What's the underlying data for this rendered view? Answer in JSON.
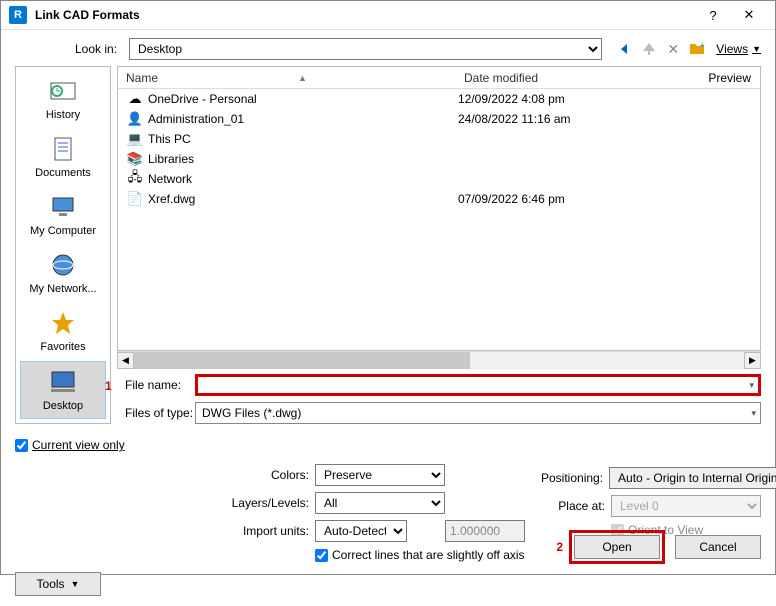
{
  "title": "Link CAD Formats",
  "lookin": {
    "label": "Look in:",
    "value": "Desktop"
  },
  "toolbar": {
    "views": "Views"
  },
  "preview_label": "Preview",
  "places": [
    {
      "label": "History"
    },
    {
      "label": "Documents"
    },
    {
      "label": "My Computer"
    },
    {
      "label": "My Network..."
    },
    {
      "label": "Favorites"
    },
    {
      "label": "Desktop"
    }
  ],
  "columns": {
    "name": "Name",
    "date": "Date modified"
  },
  "files": [
    {
      "name": "OneDrive - Personal",
      "date": "12/09/2022 4:08 pm",
      "icon": "☁"
    },
    {
      "name": "Administration_01",
      "date": "24/08/2022 11:16 am",
      "icon": "👤"
    },
    {
      "name": "This PC",
      "date": "",
      "icon": "💻"
    },
    {
      "name": "Libraries",
      "date": "",
      "icon": "📚"
    },
    {
      "name": "Network",
      "date": "",
      "icon": "🖧"
    },
    {
      "name": "Xref.dwg",
      "date": "07/09/2022 6:46 pm",
      "icon": "📄"
    }
  ],
  "file_name": {
    "label": "File name:",
    "value": ""
  },
  "file_type": {
    "label": "Files of type:",
    "value": "DWG Files  (*.dwg)"
  },
  "current_view": "Current view only",
  "opts": {
    "colors_label": "Colors:",
    "colors": "Preserve",
    "layers_label": "Layers/Levels:",
    "layers": "All",
    "units_label": "Import units:",
    "units": "Auto-Detect",
    "units_val": "1.000000",
    "correct_off_axis": "Correct lines that are slightly off axis",
    "positioning_label": "Positioning:",
    "positioning": "Auto - Origin to Internal Origin",
    "placeat_label": "Place at:",
    "placeat": "Level 0",
    "orient": "Orient to View"
  },
  "tools": "Tools",
  "open": "Open",
  "cancel": "Cancel",
  "annot1": "1",
  "annot2": "2"
}
